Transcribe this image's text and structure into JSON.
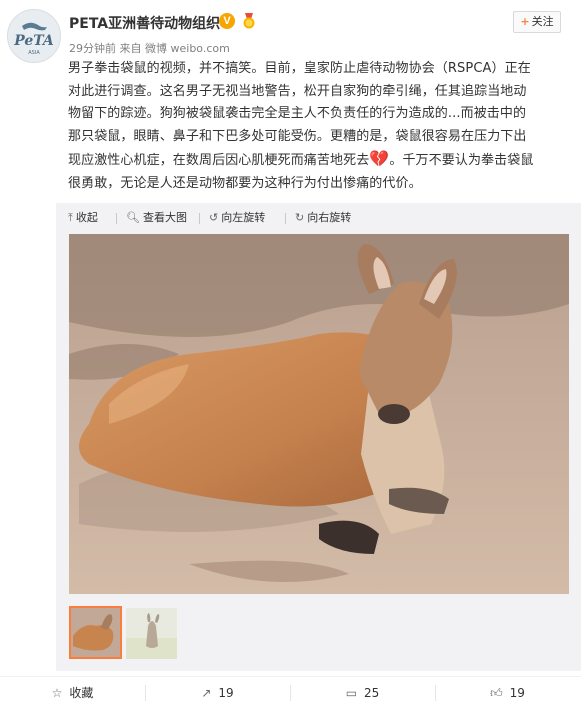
{
  "post": {
    "author": "PETA亚洲善待动物组织",
    "verified_badge": "V",
    "time": "29分钟前",
    "source_prefix": "来自",
    "source": "微博 weibo.com",
    "follow_label": "关注",
    "text_lines": [
      "男子拳击袋鼠的视频，并不搞笑。目前，皇家防止虐待动物协会（RSPCA）正在",
      "对此进行调查。这名男子无视当地警告，松开自家狗的牵引绳，任其追踪当地动",
      "物留下的踪迹。狗狗被袋鼠袭击完全是主人不负责任的行为造成的...而被击中的",
      "那只袋鼠，眼睛、鼻子和下巴多处可能受伤。更糟的是，袋鼠很容易在压力下出",
      "现应激性心机症，在数周后因心肌梗死而痛苦地死去",
      "。千万不要认为拳击袋鼠",
      "很勇敢，无论是人还是动物都要为这种行为付出惨痛的代价。"
    ],
    "heart_emoji": "💔"
  },
  "media_toolbar": {
    "collapse": "收起",
    "view_large": "查看大图",
    "rotate_left": "向左旋转",
    "rotate_right": "向右旋转"
  },
  "footer": {
    "favorite": "收藏",
    "repost_count": "19",
    "comment_count": "25",
    "like_count": "19"
  },
  "colors": {
    "accent_orange": "#fa7d3c",
    "badge_gold": "#f7a500"
  },
  "avatar_logo": "PeTA",
  "avatar_sub": "ASIA"
}
